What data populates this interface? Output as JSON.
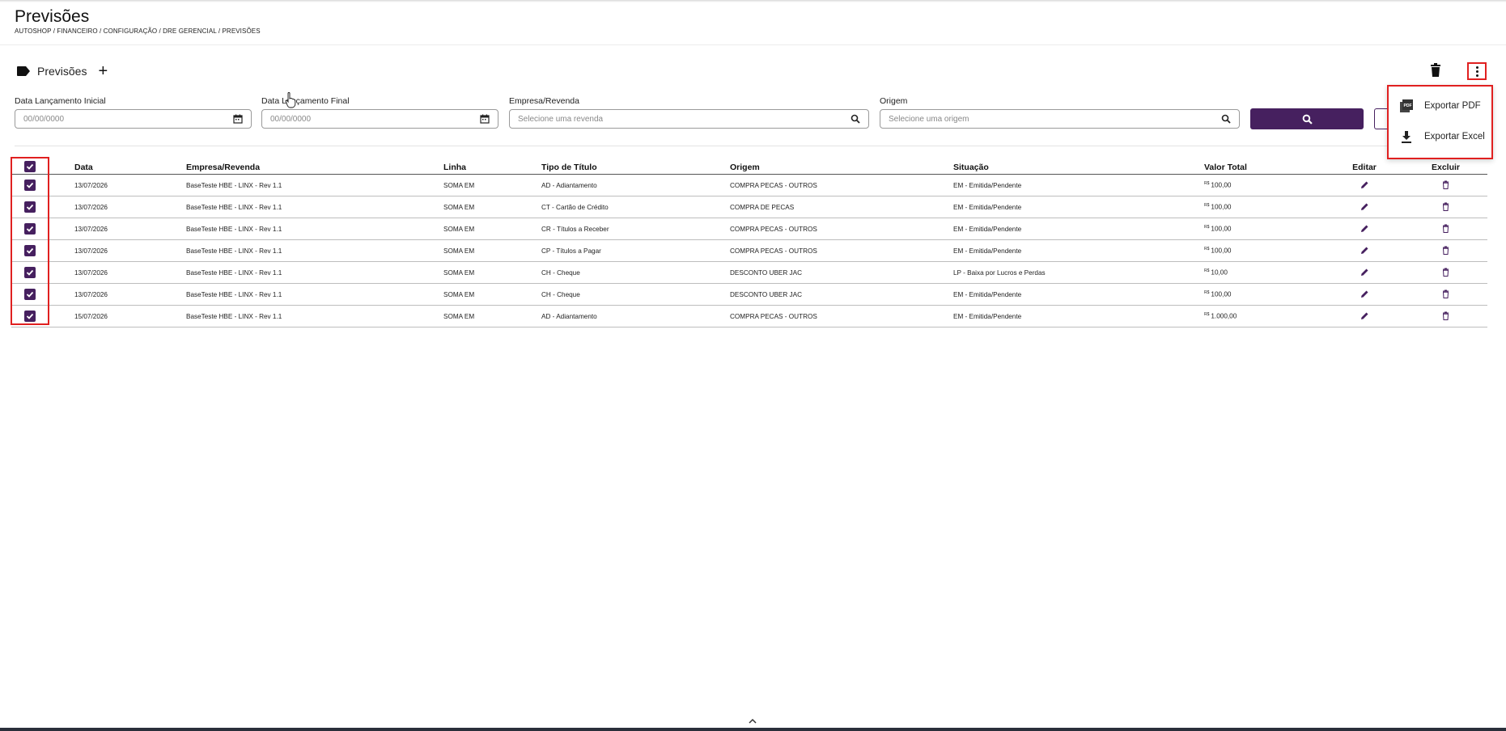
{
  "page": {
    "title": "Previsões",
    "breadcrumb": "AUTOSHOP / FINANCEIRO / CONFIGURAÇÃO / DRE GERENCIAL / PREVISÕES"
  },
  "section": {
    "title": "Previsões",
    "add_label": "+"
  },
  "filters": {
    "data_inicial": {
      "label": "Data Lançamento Inicial",
      "placeholder": "00/00/0000"
    },
    "data_final": {
      "label": "Data Lançamento Final",
      "placeholder": "00/00/0000"
    },
    "empresa": {
      "label": "Empresa/Revenda",
      "placeholder": "Selecione uma revenda"
    },
    "origem": {
      "label": "Origem",
      "placeholder": "Selecione uma origem"
    }
  },
  "menu": {
    "export_pdf": "Exportar PDF",
    "export_excel": "Exportar Excel"
  },
  "table": {
    "headers": [
      "Data",
      "Empresa/Revenda",
      "Linha",
      "Tipo de Título",
      "Origem",
      "Situação",
      "Valor Total",
      "Editar",
      "Excluir"
    ],
    "currency": "R$",
    "rows": [
      {
        "data": "13/07/2026",
        "empresa": "BaseTeste HBE - LINX - Rev 1.1",
        "linha": "SOMA EM",
        "tipo": "AD - Adiantamento",
        "origem": "COMPRA PECAS - OUTROS",
        "situacao": "EM - Emitida/Pendente",
        "valor": "100,00"
      },
      {
        "data": "13/07/2026",
        "empresa": "BaseTeste HBE - LINX - Rev 1.1",
        "linha": "SOMA EM",
        "tipo": "CT - Cartão de Crédito",
        "origem": "COMPRA DE PECAS",
        "situacao": "EM - Emitida/Pendente",
        "valor": "100,00"
      },
      {
        "data": "13/07/2026",
        "empresa": "BaseTeste HBE - LINX - Rev 1.1",
        "linha": "SOMA EM",
        "tipo": "CR - Títulos a Receber",
        "origem": "COMPRA PECAS - OUTROS",
        "situacao": "EM - Emitida/Pendente",
        "valor": "100,00"
      },
      {
        "data": "13/07/2026",
        "empresa": "BaseTeste HBE - LINX - Rev 1.1",
        "linha": "SOMA EM",
        "tipo": "CP - Títulos a Pagar",
        "origem": "COMPRA PECAS - OUTROS",
        "situacao": "EM - Emitida/Pendente",
        "valor": "100,00"
      },
      {
        "data": "13/07/2026",
        "empresa": "BaseTeste HBE - LINX - Rev 1.1",
        "linha": "SOMA EM",
        "tipo": "CH - Cheque",
        "origem": "DESCONTO UBER JAC",
        "situacao": "LP - Baixa por Lucros e Perdas",
        "valor": "10,00"
      },
      {
        "data": "13/07/2026",
        "empresa": "BaseTeste HBE - LINX - Rev 1.1",
        "linha": "SOMA EM",
        "tipo": "CH - Cheque",
        "origem": "DESCONTO UBER JAC",
        "situacao": "EM - Emitida/Pendente",
        "valor": "100,00"
      },
      {
        "data": "15/07/2026",
        "empresa": "BaseTeste HBE - LINX - Rev 1.1",
        "linha": "SOMA EM",
        "tipo": "AD - Adiantamento",
        "origem": "COMPRA PECAS - OUTROS",
        "situacao": "EM - Emitida/Pendente",
        "valor": "1.000,00"
      }
    ]
  },
  "colors": {
    "primary": "#46205f",
    "highlight": "#e02020"
  }
}
